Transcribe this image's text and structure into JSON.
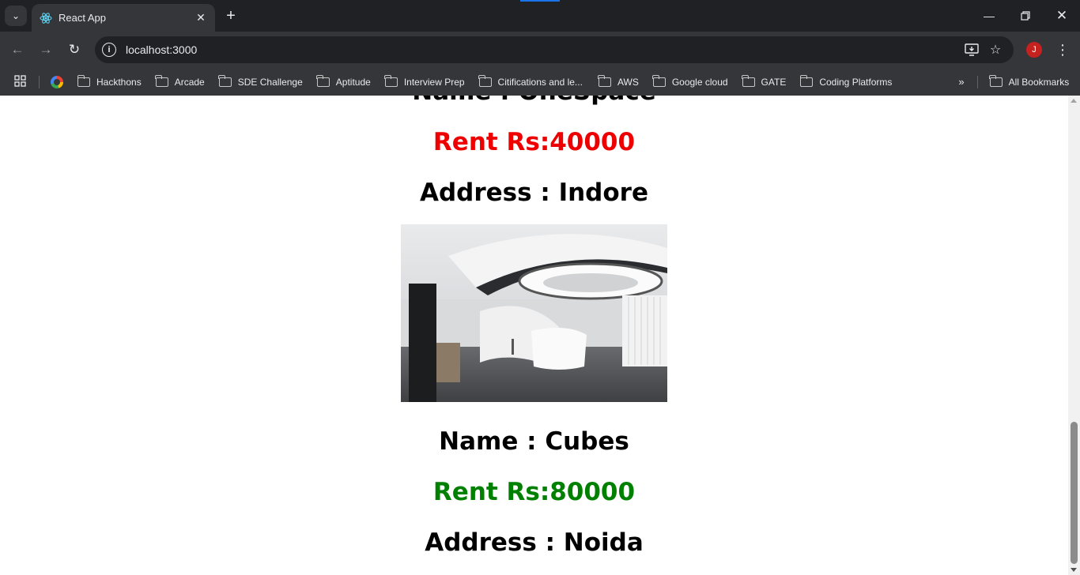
{
  "browser": {
    "tab_title": "React App",
    "url": "localhost:3000",
    "profile_initial": "J",
    "accent_color": "#1a73e8"
  },
  "bookmarks": [
    {
      "label": "Hackthons",
      "icon": "folder-icon"
    },
    {
      "label": "Arcade",
      "icon": "folder-icon"
    },
    {
      "label": "SDE Challenge",
      "icon": "folder-icon"
    },
    {
      "label": "Aptitude",
      "icon": "folder-icon"
    },
    {
      "label": "Interview Prep",
      "icon": "folder-icon"
    },
    {
      "label": "Citifications and le...",
      "icon": "folder-icon"
    },
    {
      "label": "AWS",
      "icon": "folder-icon"
    },
    {
      "label": "Google cloud",
      "icon": "folder-icon"
    },
    {
      "label": "GATE",
      "icon": "folder-icon"
    },
    {
      "label": "Coding Platforms",
      "icon": "folder-icon"
    }
  ],
  "all_bookmarks_label": "All Bookmarks",
  "spaces": [
    {
      "name": "Name : OneSpace",
      "rent": "Rent Rs:40000",
      "rent_color": "#ee0000",
      "address": "Address : Indore"
    },
    {
      "name": "Name : Cubes",
      "rent": "Rent Rs:80000",
      "rent_color": "#008000",
      "address": "Address : Noida"
    }
  ]
}
